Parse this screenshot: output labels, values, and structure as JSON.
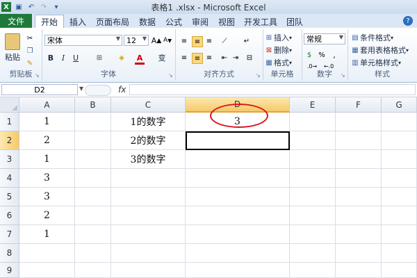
{
  "window": {
    "title": "表格1 .xlsx - Microsoft Excel"
  },
  "tabs": {
    "file": "文件",
    "home": "开始",
    "insert": "插入",
    "layout": "页面布局",
    "data": "数据",
    "formulas": "公式",
    "review": "审阅",
    "view": "视图",
    "developer": "开发工具",
    "team": "团队"
  },
  "ribbon": {
    "clipboard": {
      "label": "剪贴板",
      "paste": "粘贴"
    },
    "font": {
      "label": "字体",
      "name": "宋体",
      "size": "12",
      "bold": "B",
      "italic": "I",
      "underline": "U",
      "font_color_letter": "A",
      "wen": "变"
    },
    "alignment": {
      "label": "对齐方式"
    },
    "cells": {
      "label": "单元格",
      "insert": "插入",
      "delete": "删除",
      "format": "格式"
    },
    "number": {
      "label": "数字",
      "format": "常规"
    },
    "styles": {
      "label": "样式",
      "conditional": "条件格式",
      "table": "套用表格格式",
      "cell_styles": "单元格样式"
    }
  },
  "formula_bar": {
    "name_box": "D2",
    "fx": "fx",
    "content": ""
  },
  "columns": [
    "A",
    "B",
    "C",
    "D",
    "E",
    "F",
    "G"
  ],
  "rows": [
    "1",
    "2",
    "3",
    "4",
    "5",
    "6",
    "7",
    "8",
    "9"
  ],
  "cells": {
    "A1": "1",
    "A2": "2",
    "A3": "1",
    "A4": "3",
    "A5": "3",
    "A6": "2",
    "A7": "1",
    "C1": "1的数字",
    "C2": "2的数字",
    "C3": "3的数字",
    "D1": "3"
  },
  "colors": {
    "file_tab": "#1f7a3a",
    "highlight_ellipse": "#d9141b",
    "selected_header": "#f6c96a"
  }
}
